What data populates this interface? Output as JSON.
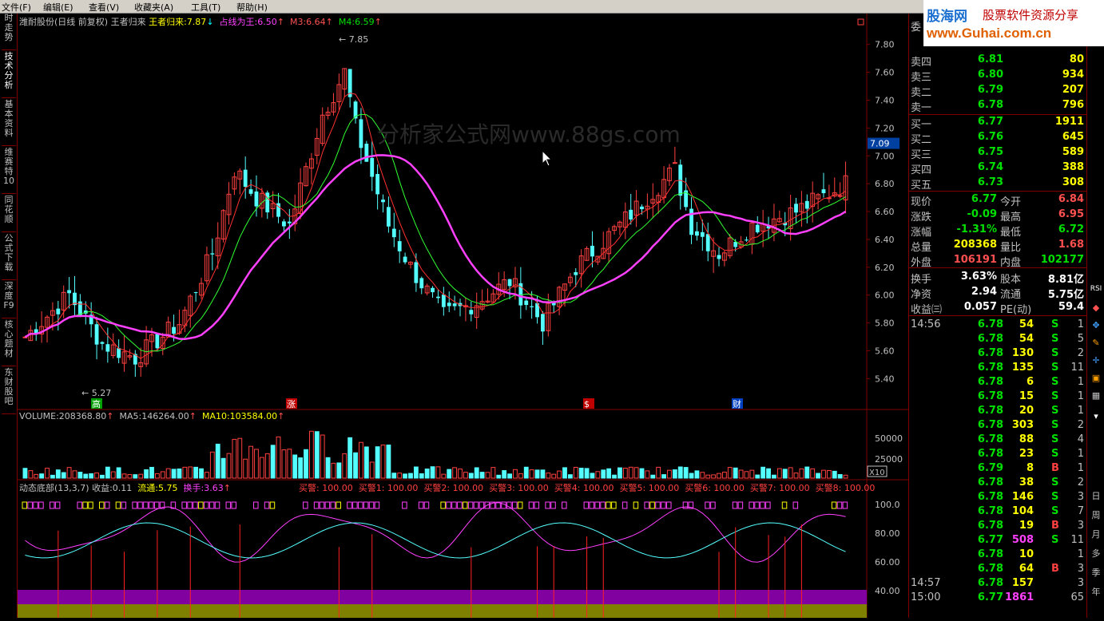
{
  "menu": [
    "文件(F)",
    "编辑(E)",
    "查看(V)",
    "收藏夹(A)",
    "工具(T)",
    "帮助(H)"
  ],
  "brand": {
    "name": "股海网",
    "slogan": "股票软件资源分享",
    "url": "www.Guhai.com.cn"
  },
  "left_tabs": [
    "时走势",
    "技术分析",
    "基本资料",
    "维赛特10",
    "同花顺",
    "公式下载",
    "深度F9",
    "核心题材",
    "东财股吧"
  ],
  "header": {
    "stock": "潍耐股份(日线 前复权)",
    "f1_name": "王者归来",
    "f1_label": "王者归来:",
    "f1_val": "7.87",
    "f2_label": "占线为王:",
    "f2_val": "6.50",
    "m3_label": "M3:",
    "m3_val": "6.64",
    "m4_label": "M4:",
    "m4_val": "6.59"
  },
  "watermark": "分析家公式网www.88gs.com",
  "price_axis": [
    "7.80",
    "7.60",
    "7.40",
    "7.20",
    "7.00",
    "6.80",
    "6.60",
    "6.40",
    "6.20",
    "6.00",
    "5.80",
    "5.60",
    "5.40"
  ],
  "price_marker": "7.09",
  "hi_label": "7.85",
  "lo_label": "5.27",
  "markers": {
    "gao": "高",
    "zhang": "涨",
    "s": "$",
    "cai": "财"
  },
  "volume": {
    "label": "VOLUME:",
    "val": "208368.80",
    "ma5_label": "MA5:",
    "ma5": "146264.00",
    "ma10_label": "MA10:",
    "ma10": "103584.00",
    "axis": [
      "50000",
      "25000"
    ],
    "unit": "X10"
  },
  "indicator": {
    "name": "动态底部(13,3,7)",
    "sy_label": "收益:",
    "sy": "0.11",
    "lt_label": "流通:",
    "lt": "5.75",
    "hs_label": "换手:",
    "hs": "3.63",
    "alerts": [
      "买警: 100.00",
      "买警1: 100.00",
      "买警2: 100.00",
      "买警3: 100.00",
      "买警4: 100.00",
      "买警5: 100.00",
      "买警6: 100.00",
      "买警7: 100.00",
      "买警8: 100.00"
    ],
    "axis": [
      "100.0",
      "80.00",
      "60.00",
      "40.00"
    ]
  },
  "orderbook": {
    "title": "委",
    "sells": [
      {
        "l": "卖五",
        "p": "",
        "v": ""
      },
      {
        "l": "卖四",
        "p": "6.81",
        "v": "80"
      },
      {
        "l": "卖三",
        "p": "6.80",
        "v": "934"
      },
      {
        "l": "卖二",
        "p": "6.79",
        "v": "207"
      },
      {
        "l": "卖一",
        "p": "6.78",
        "v": "796"
      }
    ],
    "buys": [
      {
        "l": "买一",
        "p": "6.77",
        "v": "1911"
      },
      {
        "l": "买二",
        "p": "6.76",
        "v": "645"
      },
      {
        "l": "买三",
        "p": "6.75",
        "v": "589"
      },
      {
        "l": "买四",
        "p": "6.74",
        "v": "388"
      },
      {
        "l": "买五",
        "p": "6.73",
        "v": "308"
      }
    ]
  },
  "quote": [
    {
      "a": "现价",
      "av": "6.77",
      "b": "今开",
      "bv": "6.84"
    },
    {
      "a": "涨跌",
      "av": "-0.09",
      "b": "最高",
      "bv": "6.95"
    },
    {
      "a": "涨幅",
      "av": "-1.31%",
      "b": "最低",
      "bv": "6.72"
    },
    {
      "a": "总量",
      "av": "208368",
      "b": "量比",
      "bv": "1.68"
    },
    {
      "a": "外盘",
      "av": "106191",
      "b": "内盘",
      "bv": "102177"
    }
  ],
  "finance": [
    {
      "a": "换手",
      "av": "3.63%",
      "b": "股本",
      "bv": "8.81亿"
    },
    {
      "a": "净资",
      "av": "2.94",
      "b": "流通",
      "bv": "5.75亿"
    },
    {
      "a": "收益㈢",
      "av": "0.057",
      "b": "PE(动)",
      "bv": "59.4"
    }
  ],
  "ticks": [
    {
      "t": "14:56",
      "p": "6.78",
      "v": "54",
      "s": "S",
      "n": "1"
    },
    {
      "t": "",
      "p": "6.78",
      "v": "54",
      "s": "S",
      "n": "5"
    },
    {
      "t": "",
      "p": "6.78",
      "v": "130",
      "s": "S",
      "n": "2"
    },
    {
      "t": "",
      "p": "6.78",
      "v": "135",
      "s": "S",
      "n": "11"
    },
    {
      "t": "",
      "p": "6.78",
      "v": "6",
      "s": "S",
      "n": "1"
    },
    {
      "t": "",
      "p": "6.78",
      "v": "15",
      "s": "S",
      "n": "1"
    },
    {
      "t": "",
      "p": "6.78",
      "v": "20",
      "s": "S",
      "n": "1"
    },
    {
      "t": "",
      "p": "6.78",
      "v": "303",
      "s": "S",
      "n": "2"
    },
    {
      "t": "",
      "p": "6.78",
      "v": "88",
      "s": "S",
      "n": "4"
    },
    {
      "t": "",
      "p": "6.78",
      "v": "23",
      "s": "S",
      "n": "1"
    },
    {
      "t": "",
      "p": "6.79",
      "v": "8",
      "s": "B",
      "n": "1"
    },
    {
      "t": "",
      "p": "6.78",
      "v": "38",
      "s": "S",
      "n": "2"
    },
    {
      "t": "",
      "p": "6.78",
      "v": "146",
      "s": "S",
      "n": "3"
    },
    {
      "t": "",
      "p": "6.78",
      "v": "104",
      "s": "S",
      "n": "7"
    },
    {
      "t": "",
      "p": "6.78",
      "v": "19",
      "s": "B",
      "n": "3"
    },
    {
      "t": "",
      "p": "6.77",
      "v": "508",
      "s": "S",
      "n": "11"
    },
    {
      "t": "",
      "p": "6.78",
      "v": "10",
      "s": "",
      "n": "1"
    },
    {
      "t": "",
      "p": "6.78",
      "v": "64",
      "s": "B",
      "n": "3"
    },
    {
      "t": "14:57",
      "p": "6.78",
      "v": "157",
      "s": "",
      "n": "3"
    },
    {
      "t": "15:00",
      "p": "6.77",
      "v": "1861",
      "s": "",
      "n": "65"
    }
  ],
  "tools": [
    "日",
    "周",
    "月",
    "多",
    "季",
    "年"
  ],
  "tools_top": [
    "RSI"
  ]
}
